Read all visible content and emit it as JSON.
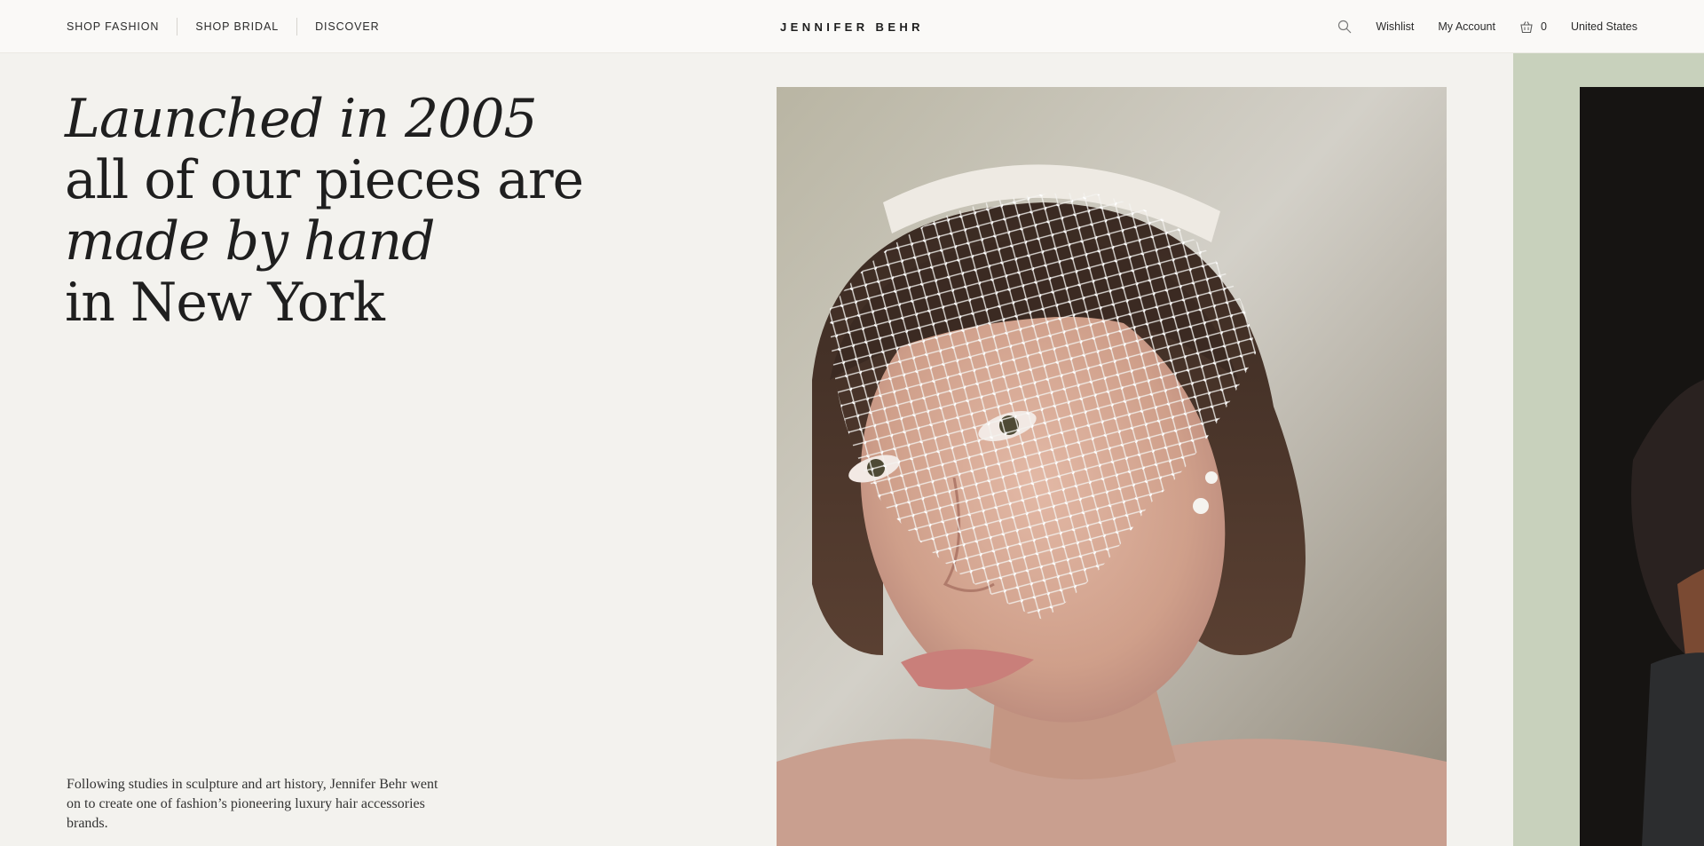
{
  "nav": {
    "left": [
      {
        "label": "SHOP FASHION"
      },
      {
        "label": "SHOP BRIDAL"
      },
      {
        "label": "DISCOVER"
      }
    ],
    "brand": "JENNIFER BEHR",
    "wishlist": "Wishlist",
    "account": "My Account",
    "cart_count": "0",
    "region": "United States",
    "icons": {
      "search": "search-icon",
      "cart": "basket-icon"
    }
  },
  "hero": {
    "line1": "Launched in 2005",
    "line2": "all of our pieces are",
    "line3": "made by hand",
    "line4": "in New York"
  },
  "intro": {
    "text": "Following studies in sculpture and art history, Jennifer Behr went on to create one of fashion’s pioneering luxury hair accessories brands."
  },
  "colors": {
    "page_bg": "#f3f2ee",
    "nav_bg": "#faf9f7",
    "green_panel": "#c8d1bc",
    "text": "#1f1f1f"
  }
}
